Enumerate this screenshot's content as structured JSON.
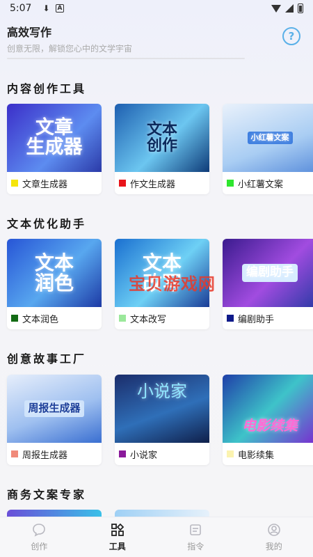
{
  "status_bar": {
    "time": "5:07",
    "download_glyph": "⬇",
    "a_glyph": "A"
  },
  "header": {
    "title": "高效写作",
    "subtitle": "创意无限，解锁您心中的文学宇宙",
    "help_glyph": "?"
  },
  "sections": [
    {
      "title": "内容创作工具",
      "cards": [
        {
          "label": "文章生成器",
          "art": "文章\n生成器",
          "swatch": "#f5e50a",
          "bg": "linear-gradient(135deg,#3b2fc9,#5d8cf0 60%,#2b3aa8)",
          "art_color": "#ffffff"
        },
        {
          "label": "作文生成器",
          "art": "文本\n创作",
          "swatch": "#e8141b",
          "bg": "linear-gradient(135deg,#1e5fb0,#6cc6f0 55%,#0e3b78)",
          "art_color": "#0d2a5c"
        },
        {
          "label": "小红薯文案",
          "art": "小红薯文案",
          "swatch": "#2ee62e",
          "bg": "linear-gradient(160deg,#e9f1fb,#a9cdf3 60%,#5d90dc)",
          "art_color": "#ffffff"
        }
      ]
    },
    {
      "title": "文本优化助手",
      "cards": [
        {
          "label": "文本润色",
          "art": "文本\n润色",
          "swatch": "#136b14",
          "bg": "linear-gradient(135deg,#2755d6,#58a7ef 55%,#1d3aa5)",
          "art_color": "#ffffff"
        },
        {
          "label": "文本改写",
          "art": "文本\n改写",
          "swatch": "#9be89b",
          "bg": "linear-gradient(135deg,#1a6fd0,#6ed0f5 55%,#1a3c96)",
          "art_color": "#ffffff"
        },
        {
          "label": "编剧助手",
          "art": "编剧助手",
          "swatch": "#0e1a8a",
          "bg": "linear-gradient(135deg,#3a1b8e,#a14ce0 55%,#2c3aa6)",
          "art_color": "#ffffff"
        }
      ]
    },
    {
      "title": "创意故事工厂",
      "cards": [
        {
          "label": "周报生成器",
          "art": "周报生成器",
          "swatch": "#f08a7a",
          "bg": "linear-gradient(160deg,#e6eefb,#9fc0f0 55%,#3a6fd1)",
          "art_color": "#1d3f99"
        },
        {
          "label": "小说家",
          "art": "小说家",
          "swatch": "#8a1a9a",
          "bg": "linear-gradient(160deg,#1b2d6b,#2f6fb8 55%,#0f1f4a)",
          "art_color": "#8fe6ff"
        },
        {
          "label": "电影续集",
          "art": "电影续集",
          "swatch": "#fbf3b0",
          "bg": "linear-gradient(135deg,#1f3fa8,#3ec3c9 50%,#7a2bd0)",
          "art_color": "#ff6ad5"
        }
      ]
    },
    {
      "title": "商务文案专家",
      "cards": []
    }
  ],
  "watermark": "宝贝游戏网",
  "bottom_nav": [
    {
      "label": "创作",
      "icon": "chat-bubble-icon",
      "active": false
    },
    {
      "label": "工具",
      "icon": "tools-icon",
      "active": true
    },
    {
      "label": "指令",
      "icon": "command-icon",
      "active": false
    },
    {
      "label": "我的",
      "icon": "profile-icon",
      "active": false
    }
  ]
}
